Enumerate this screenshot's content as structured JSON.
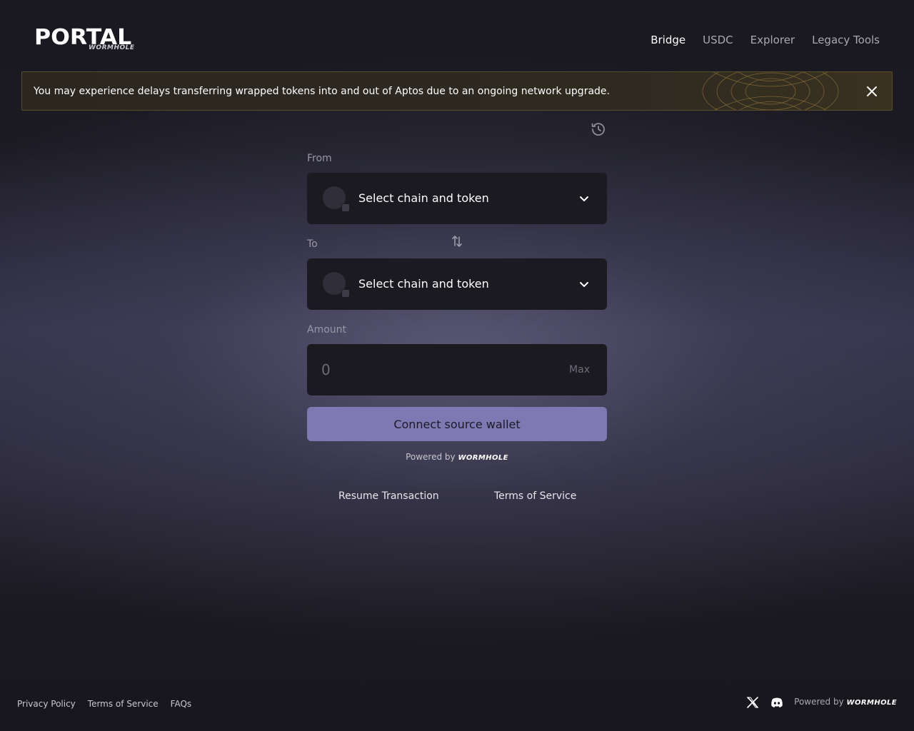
{
  "brand": {
    "title": "PORTAL",
    "subtitle": "WORMHOLE"
  },
  "nav": {
    "items": [
      {
        "label": "Bridge",
        "active": true
      },
      {
        "label": "USDC",
        "active": false
      },
      {
        "label": "Explorer",
        "active": false
      },
      {
        "label": "Legacy Tools",
        "active": false
      }
    ]
  },
  "banner": {
    "message": "You may experience delays transferring wrapped tokens into and out of Aptos due to an ongoing network upgrade.",
    "close_icon": "close-icon"
  },
  "history": {
    "icon": "history-icon"
  },
  "form": {
    "from_label": "From",
    "from_placeholder": "Select chain and token",
    "to_label": "To",
    "to_placeholder": "Select chain and token",
    "swap_icon": "swap-icon",
    "amount_label": "Amount",
    "amount_placeholder": "0",
    "max_label": "Max",
    "connect_button": "Connect source wallet",
    "powered_by": "Powered by",
    "powered_logo": "WORMHOLE"
  },
  "links": {
    "resume": "Resume Transaction",
    "terms": "Terms of Service"
  },
  "footer": {
    "links": [
      "Privacy Policy",
      "Terms of Service",
      "FAQs"
    ],
    "social": [
      "x-icon",
      "discord-icon"
    ],
    "powered_by": "Powered by",
    "powered_logo": "WORMHOLE"
  },
  "colors": {
    "background": "#19181f",
    "card": "#1b1a21",
    "accent": "#7f78b3",
    "banner_border": "#5a4d2d"
  }
}
